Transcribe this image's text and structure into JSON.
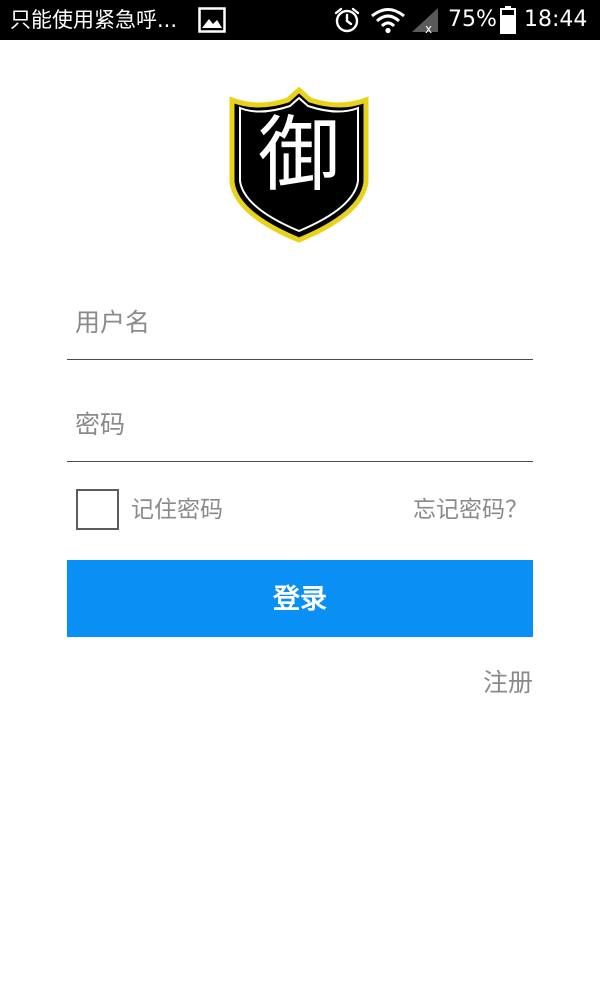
{
  "status_bar": {
    "notification_text": "只能使用紧急呼...",
    "battery_percent": "75%",
    "time": "18:44",
    "icons": [
      "image-icon",
      "alarm-icon",
      "wifi-icon",
      "signal-icon",
      "battery-icon"
    ]
  },
  "logo": {
    "character": "御",
    "icon": "shield-logo",
    "colors": {
      "border": "#e8d21a",
      "fill": "#000000",
      "text": "#ffffff"
    }
  },
  "form": {
    "username_placeholder": "用户名",
    "username_value": "",
    "password_placeholder": "密码",
    "password_value": "",
    "remember_label": "记住密码",
    "remember_checked": false,
    "forgot_label": "忘记密码？",
    "login_label": "登录",
    "register_label": "注册"
  },
  "colors": {
    "accent": "#0a8ff5",
    "hint_text": "#8a8a8a",
    "divider": "#4a4a4a",
    "status_bar": "#000000"
  }
}
